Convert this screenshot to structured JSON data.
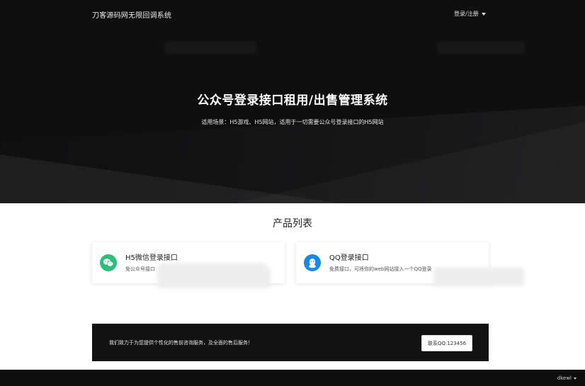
{
  "header": {
    "site_title": "刀客源码网无限回调系统",
    "login_label": "登录/注册"
  },
  "hero": {
    "title": "公众号登录接口租用/出售管理系统",
    "subtitle": "适用场景：H5游戏、H5网站，适用于一切需要公众号登录接口的H5网站"
  },
  "products": {
    "section_title": "产品列表",
    "items": [
      {
        "name": "H5微信登录接口",
        "desc": "免公众号接口",
        "icon": "wechat-icon",
        "color": "#2bbf7a"
      },
      {
        "name": "QQ登录接口",
        "desc": "免费接口，可将你的web网站接入一个QQ登录",
        "icon": "qq-icon",
        "color": "#1a89e6"
      }
    ]
  },
  "contact": {
    "message": "我们致力于为您提供个性化的售前咨询服务，及全面的售后服务！",
    "button_label": "联系QQ:123456"
  },
  "footer": {
    "user_label": "dkewl"
  },
  "colors": {
    "hero_bg": "#0f0f10",
    "wechat_green": "#2bbf7a",
    "qq_blue": "#1a89e6"
  }
}
